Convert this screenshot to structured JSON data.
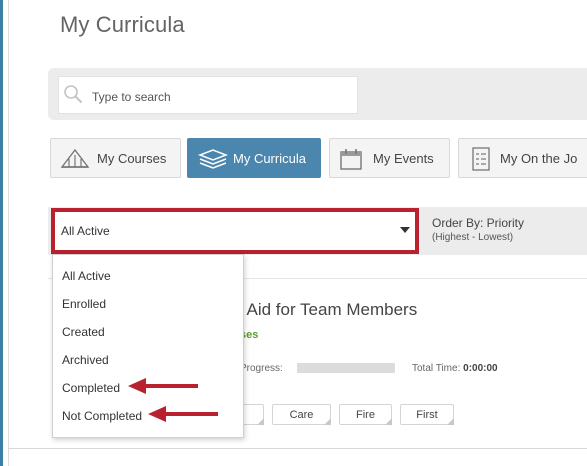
{
  "page": {
    "title": "My Curricula"
  },
  "search": {
    "placeholder": "Type to search"
  },
  "tabs": [
    {
      "label": "My Courses",
      "icon": "courses-icon",
      "active": false
    },
    {
      "label": "My Curricula",
      "icon": "curricula-icon",
      "active": true
    },
    {
      "label": "My Events",
      "icon": "calendar-icon",
      "active": false
    },
    {
      "label": "My On the Jo",
      "icon": "checklist-icon",
      "active": false
    }
  ],
  "filter": {
    "selected": "All Active",
    "options": [
      "All Active",
      "Enrolled",
      "Created",
      "Archived",
      "Completed",
      "Not Completed"
    ]
  },
  "order": {
    "label": "Order By: Priority",
    "sub": "(Highest - Lowest)"
  },
  "course": {
    "title": ": Aid for Team Members",
    "subtitle": "ses",
    "progress_label": "Progress:",
    "progress": 0,
    "time_label": "Total Time:",
    "time_value": "0:00:00",
    "tags": [
      "",
      "Care",
      "Fire",
      "First"
    ]
  },
  "colors": {
    "accent": "#4a86ad",
    "highlight": "#b8212d",
    "success": "#5aa02c"
  }
}
